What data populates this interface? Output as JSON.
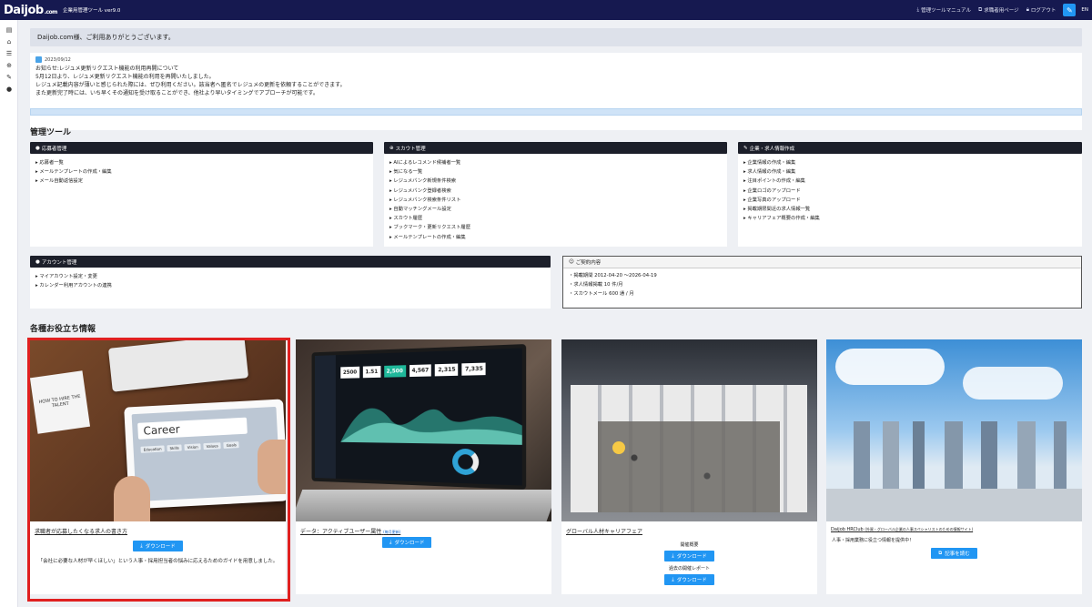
{
  "header": {
    "logo": "Daijob",
    "logo_suffix": ".com",
    "tool_title": "企業用管理ツール ver9.0",
    "links": [
      {
        "label": "管理ツールマニュアル",
        "icon": "download-icon"
      },
      {
        "label": "求職者用ページ",
        "icon": "external-link-icon"
      },
      {
        "label": "ログアウト",
        "icon": "lock-icon"
      }
    ],
    "pin_icon": "pin-icon",
    "lang": "EN"
  },
  "sidebar": {
    "icons": [
      "list-icon",
      "home-icon",
      "database-icon",
      "search-icon",
      "edit-icon",
      "user-icon"
    ]
  },
  "welcome": "Daijob.com様、ご利用ありがとうございます。",
  "notice": {
    "date": "2023/09/12",
    "lines": [
      "お知らせ:レジュメ更新リクエスト機能の利用再開について",
      "5月12日より、レジュメ更新リクエスト機能の利用を再開いたしました。",
      "レジュメ記載内容が薄いと感じられた際には、ぜひ利用ください。該当者へ匿名でレジュメの更新を依頼することができます。",
      "また更新完了時には、いち早くその通知を受け取ることができ、他社より早いタイミングでアプローチが可能です。"
    ]
  },
  "tools_title": "管理ツール",
  "panels": {
    "applicants": {
      "title": "応募者管理",
      "items": [
        "応募者一覧",
        "メールテンプレートの作成・編集",
        "メール自動返信設定"
      ]
    },
    "scout": {
      "title": "スカウト管理",
      "items": [
        "AIによるレコメンド候補者一覧",
        "気になる一覧",
        "レジュメバンク新規条件検索",
        "レジュメバンク登録者検索",
        "レジュメバンク検索条件リスト",
        "自動マッチングメール設定",
        "スカウト履歴",
        "ブックマーク・更新リクエスト履歴",
        "メールテンプレートの作成・編集"
      ]
    },
    "company": {
      "title": "企業・求人情報作成",
      "items": [
        "企業情報の作成・編集",
        "求人情報の作成・編集",
        "注目ポイントの作成・編集",
        "企業ロゴのアップロード",
        "企業写真のアップロード",
        "掲載期限間近の求人情報一覧",
        "キャリアフェア概要の作成・編集"
      ]
    },
    "account": {
      "title": "アカウント管理",
      "items": [
        "マイアカウント設定・変更",
        "カレンダー利用アカウントの連携"
      ]
    },
    "contract": {
      "title": "ご契約内容",
      "items": [
        "掲載期間 2012-04-20 〜2026-04-19",
        "求人情報掲載 10 件/月",
        "スカウトメール 600 通 / 月"
      ]
    }
  },
  "info_title": "各種お役立ち情報",
  "cards": [
    {
      "title": "求職者が応募したくなる求人の書き方",
      "button": "ダウンロード",
      "desc": "「会社に必要な人材が早くほしい」という人事・採用担当者の悩みに応えるためのガイドを用意しました。",
      "thumb_text": "Career",
      "tags": [
        "Education",
        "Skills",
        "Vision",
        "Values",
        "Goals"
      ],
      "note": "HOW TO HIRE THE TALENT"
    },
    {
      "title": "データ：アクティブユーザー属性",
      "title_note": "(毎月更新)",
      "button": "ダウンロード"
    },
    {
      "title": "グローバル人材キャリアフェア",
      "sub1": "開催概要",
      "button1": "ダウンロード",
      "sub2": "過去の開催レポート",
      "button2": "ダウンロード"
    },
    {
      "title": "Daijob HRClub",
      "title_note": "(外資・グローバル企業の人事スペシャリストのための情報サイト)",
      "desc": "人事・採用業務に役立つ情報を提供中！",
      "button": "記事を読む"
    }
  ],
  "dashboard_stats": [
    "2500",
    "1.51",
    "2,500",
    "4,567",
    "2,315",
    "7,335"
  ]
}
